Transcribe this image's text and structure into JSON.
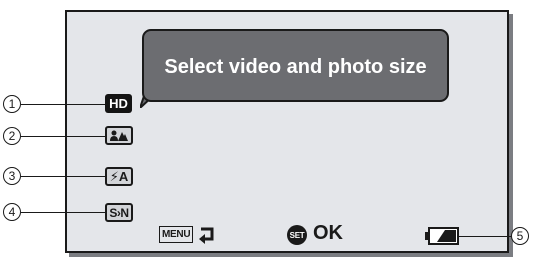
{
  "tooltip": {
    "text": "Select video and photo size"
  },
  "icons": {
    "hd": "HD",
    "flash": "⚡A",
    "sn": "S›N"
  },
  "callouts": [
    "1",
    "2",
    "3",
    "4",
    "5"
  ],
  "bottom_bar": {
    "menu_label": "MENU",
    "set_label": "SET",
    "ok_label": "OK"
  }
}
